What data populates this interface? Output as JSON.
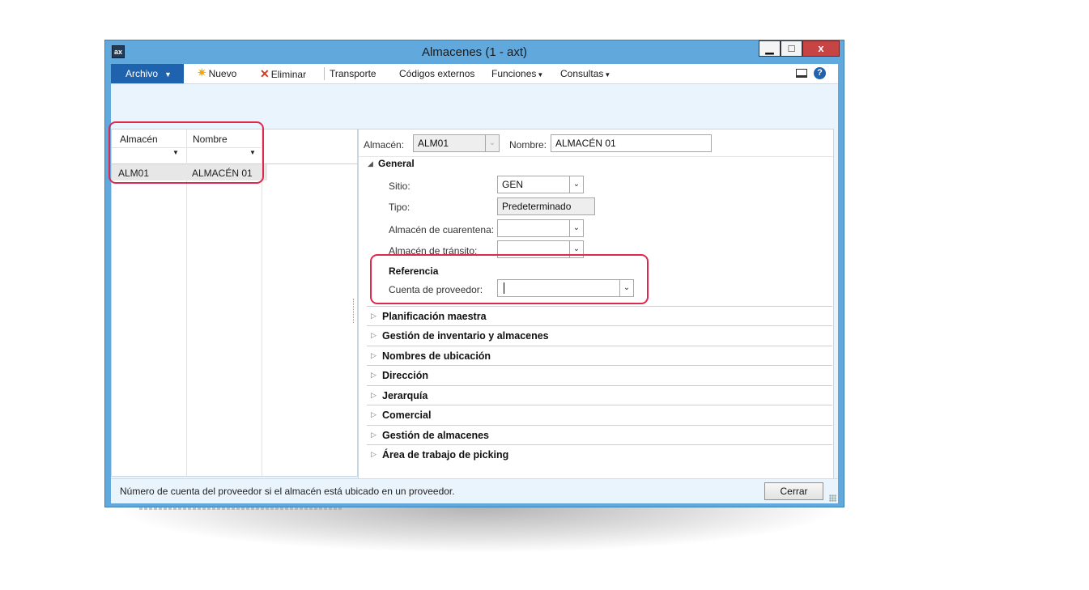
{
  "window": {
    "title": "Almacenes (1 - axt)",
    "app_icon": "ax-app-icon",
    "controls": {
      "minimize": "▁",
      "maximize": "□",
      "close": "x"
    }
  },
  "menu": {
    "archivo": "Archivo",
    "nuevo": "Nuevo",
    "eliminar": "Eliminar",
    "transporte": "Transporte",
    "codigos_externos": "Códigos externos",
    "funciones": "Funciones",
    "consultas": "Consultas"
  },
  "grid": {
    "columns": [
      "Almacén",
      "Nombre"
    ],
    "rows": [
      {
        "almacen": "ALM01",
        "nombre": "ALMACÉN 01"
      }
    ]
  },
  "header": {
    "almacen_label": "Almacén:",
    "almacen_value": "ALM01",
    "nombre_label": "Nombre:",
    "nombre_value": "ALMACÉN 01"
  },
  "general": {
    "title": "General",
    "sitio_label": "Sitio:",
    "sitio_value": "GEN",
    "tipo_label": "Tipo:",
    "tipo_value": "Predeterminado",
    "cuarentena_label": "Almacén de cuarentena:",
    "cuarentena_value": "",
    "transito_label": "Almacén de tránsito:",
    "transito_value": "",
    "referencia_title": "Referencia",
    "proveedor_label": "Cuenta de proveedor:",
    "proveedor_value": ""
  },
  "fasttabs": [
    "Planificación maestra",
    "Gestión de inventario y almacenes",
    "Nombres de ubicación",
    "Dirección",
    "Jerarquía",
    "Comercial",
    "Gestión de almacenes",
    "Área de trabajo de picking"
  ],
  "status": {
    "text": "Número de cuenta del proveedor si el almacén está ubicado en un proveedor.",
    "close_label": "Cerrar"
  },
  "colors": {
    "frame": "#61a8dc",
    "archivo": "#1f62ad",
    "highlight": "#e0284e"
  }
}
